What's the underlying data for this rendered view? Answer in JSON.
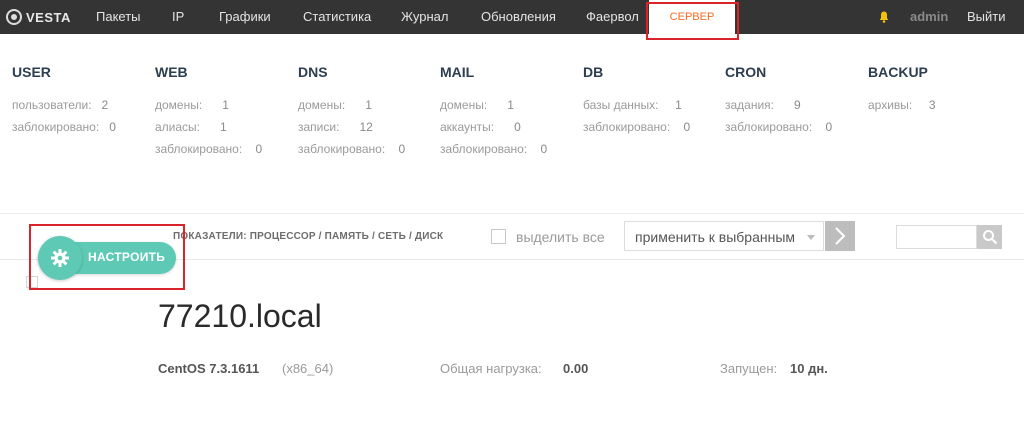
{
  "app": {
    "logo": "VESTA"
  },
  "nav": {
    "items": [
      {
        "label": "Пакеты"
      },
      {
        "label": "IP"
      },
      {
        "label": "Графики"
      },
      {
        "label": "Статистика"
      },
      {
        "label": "Журнал"
      },
      {
        "label": "Обновления"
      },
      {
        "label": "Фаервол"
      },
      {
        "label": "СЕРВЕР"
      }
    ],
    "active": "СЕРВЕР",
    "user": "admin",
    "logout": "Выйти"
  },
  "stats": [
    {
      "title": "USER",
      "rows": [
        {
          "label": "пользователи:",
          "value": "2"
        },
        {
          "label": "заблокировано:",
          "value": "0"
        }
      ]
    },
    {
      "title": "WEB",
      "rows": [
        {
          "label": "домены:",
          "value": "1"
        },
        {
          "label": "алиасы:",
          "value": "1"
        },
        {
          "label": "заблокировано:",
          "value": "0"
        }
      ]
    },
    {
      "title": "DNS",
      "rows": [
        {
          "label": "домены:",
          "value": "1"
        },
        {
          "label": "записи:",
          "value": "12"
        },
        {
          "label": "заблокировано:",
          "value": "0"
        }
      ]
    },
    {
      "title": "MAIL",
      "rows": [
        {
          "label": "домены:",
          "value": "1"
        },
        {
          "label": "аккаунты:",
          "value": "0"
        },
        {
          "label": "заблокировано:",
          "value": "0"
        }
      ]
    },
    {
      "title": "DB",
      "rows": [
        {
          "label": "базы данных:",
          "value": "1"
        },
        {
          "label": "заблокировано:",
          "value": "0"
        }
      ]
    },
    {
      "title": "CRON",
      "rows": [
        {
          "label": "задания:",
          "value": "9"
        },
        {
          "label": "заблокировано:",
          "value": "0"
        }
      ]
    },
    {
      "title": "BACKUP",
      "rows": [
        {
          "label": "архивы:",
          "value": "3"
        }
      ]
    }
  ],
  "toolbar": {
    "configure": "НАСТРОИТЬ",
    "metrics": "ПОКАЗАТЕЛИ: ПРОЦЕССОР / ПАМЯТЬ / СЕТЬ / ДИСК",
    "select_all": "выделить все",
    "bulk_action": "применить к выбранным",
    "search_placeholder": ""
  },
  "server": {
    "hostname": "77210.local",
    "os": "CentOS 7.3.1611",
    "arch": "(x86_64)",
    "load_label": "Общая нагрузка:",
    "load_value": "0.00",
    "uptime_label": "Запущен:",
    "uptime_value": "10 дн."
  },
  "colors": {
    "nav_bg": "#343434",
    "accent": "#f26d22",
    "configure_green": "#5ecab5",
    "highlight": "#d9252a"
  }
}
